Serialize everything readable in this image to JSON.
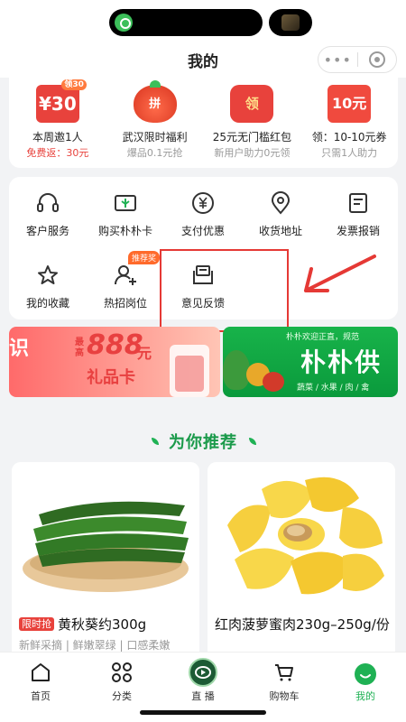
{
  "nav": {
    "title": "我的",
    "more_icon": "•••"
  },
  "promos": [
    {
      "icon": "coupon-30-icon",
      "icon_text": "¥30",
      "icon_tag": "领30",
      "title": "本周邀1人",
      "subtitle": "免费返：30元",
      "subtitle_color": "#e8423c"
    },
    {
      "icon": "pin-lantern-icon",
      "icon_text": "拼",
      "title": "武汉限时福利",
      "subtitle": "爆品0.1元抢"
    },
    {
      "icon": "ling-envelope-icon",
      "icon_text": "领",
      "title": "25元无门槛红包",
      "subtitle": "新用户助力0元领"
    },
    {
      "icon": "coupon-10-icon",
      "icon_text": "10元",
      "title": "领：10-10元券",
      "subtitle": "只需1人助力"
    }
  ],
  "services": [
    {
      "icon": "headset-icon",
      "label": "客户服务"
    },
    {
      "icon": "card-icon",
      "label": "购买朴朴卡"
    },
    {
      "icon": "yen-icon",
      "label": "支付优惠"
    },
    {
      "icon": "location-icon",
      "label": "收货地址"
    },
    {
      "icon": "invoice-icon",
      "label": "发票报销"
    },
    {
      "icon": "star-icon",
      "label": "我的收藏"
    },
    {
      "icon": "person-add-icon",
      "label": "热招岗位",
      "badge": "推荐奖"
    },
    {
      "icon": "feedback-icon",
      "label": "意见反馈"
    }
  ],
  "banners": {
    "left": {
      "glyph": "识",
      "small": "最高",
      "amount": "888",
      "unit": "元",
      "card": "礼品卡"
    },
    "right": {
      "top_text": "朴朴欢迎正直，规范",
      "title": "朴朴供",
      "bottom_text": "蔬菜 / 水果 / 肉 / 禽"
    }
  },
  "section": {
    "title": "为你推荐"
  },
  "products": [
    {
      "tag": "限时抢",
      "name": "黄秋葵约300g",
      "tags": "新鲜采摘 | 鲜嫩翠绿 | 口感柔嫩"
    },
    {
      "name": "红肉菠萝蜜肉230g–250g/份"
    }
  ],
  "tabs": [
    {
      "icon": "home-icon",
      "label": "首页"
    },
    {
      "icon": "category-icon",
      "label": "分类"
    },
    {
      "icon": "live-icon",
      "label": "直 播"
    },
    {
      "icon": "cart-icon",
      "label": "购物车"
    },
    {
      "icon": "me-icon",
      "label": "我的",
      "active": true
    }
  ],
  "colors": {
    "brand_green": "#1fb154",
    "accent_red": "#e8423c",
    "annotation_red": "#e53935"
  }
}
